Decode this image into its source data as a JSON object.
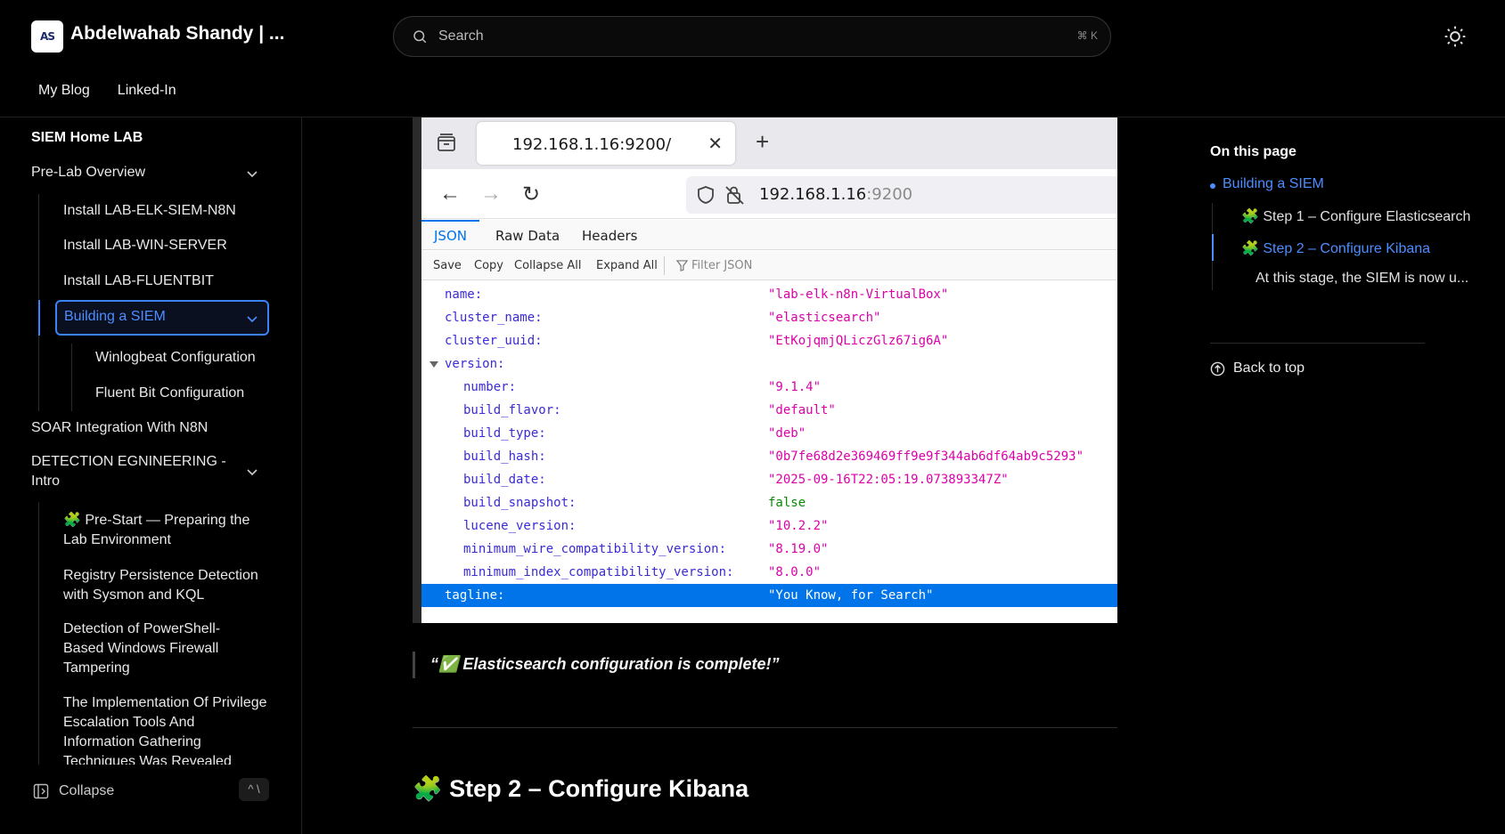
{
  "header": {
    "site_title": "Abdelwahab Shandy | ...",
    "logo_text": "AS",
    "search_placeholder": "Search",
    "search_shortcut": "⌘ K",
    "nav": [
      "My Blog",
      "Linked-In"
    ]
  },
  "sidebar": {
    "section": "SIEM Home LAB",
    "items": [
      "Pre-Lab Overview",
      "Install LAB-ELK-SIEM-N8N",
      "Install LAB-WIN-SERVER",
      "Install LAB-FLUENTBIT",
      "Building a SIEM",
      "Winlogbeat Configuration",
      "Fluent Bit Configuration",
      "SOAR Integration With N8N",
      "DETECTION EGNINEERING - Intro",
      "🧩 Pre-Start — Preparing the Lab Environment",
      "Registry Persistence Detection with Sysmon and KQL",
      "Detection of PowerShell-Based Windows Firewall Tampering",
      "The Implementation Of Privilege Escalation Tools And Information Gathering Techniques Was Revealed"
    ],
    "collapse_label": "Collapse",
    "collapse_shortcut": "^ \\"
  },
  "browser": {
    "tab_title": "192.168.1.16:9200/",
    "url_host": "192.168.1.16",
    "url_port": ":9200",
    "viewer_tabs": [
      "JSON",
      "Raw Data",
      "Headers"
    ],
    "toolbar": [
      "Save",
      "Copy",
      "Collapse All",
      "Expand All",
      "Filter JSON"
    ],
    "rows": [
      {
        "key": "name:",
        "value": "\"lab-elk-n8n-VirtualBox\""
      },
      {
        "key": "cluster_name:",
        "value": "\"elasticsearch\""
      },
      {
        "key": "cluster_uuid:",
        "value": "\"EtKojqmjQLiczGlz67ig6A\""
      },
      {
        "key": "version:",
        "value": ""
      },
      {
        "key": "number:",
        "value": "\"9.1.4\""
      },
      {
        "key": "build_flavor:",
        "value": "\"default\""
      },
      {
        "key": "build_type:",
        "value": "\"deb\""
      },
      {
        "key": "build_hash:",
        "value": "\"0b7fe68d2e369469ff9e9f344ab6df64ab9c5293\""
      },
      {
        "key": "build_date:",
        "value": "\"2025-09-16T22:05:19.073893347Z\""
      },
      {
        "key": "build_snapshot:",
        "value": "false"
      },
      {
        "key": "lucene_version:",
        "value": "\"10.2.2\""
      },
      {
        "key": "minimum_wire_compatibility_version:",
        "value": "\"8.19.0\""
      },
      {
        "key": "minimum_index_compatibility_version:",
        "value": "\"8.0.0\""
      },
      {
        "key": "tagline:",
        "value": "\"You Know, for Search\""
      }
    ]
  },
  "content": {
    "quote": "“✅ Elasticsearch configuration is complete!”",
    "heading": "🧩 Step 2 – Configure Kibana"
  },
  "toc": {
    "title": "On this page",
    "items": [
      "Building a SIEM",
      "🧩 Step 1 – Configure Elasticsearch",
      "🧩 Step 2 – Configure Kibana",
      "At this stage, the SIEM is now u..."
    ],
    "back_to_top": "Back to top"
  },
  "colors": {
    "accent": "#3b82f6",
    "json_key": "#3a2bd5",
    "json_string": "#dd00a9",
    "json_bool": "#058b00",
    "json_selected": "#0074e8"
  }
}
